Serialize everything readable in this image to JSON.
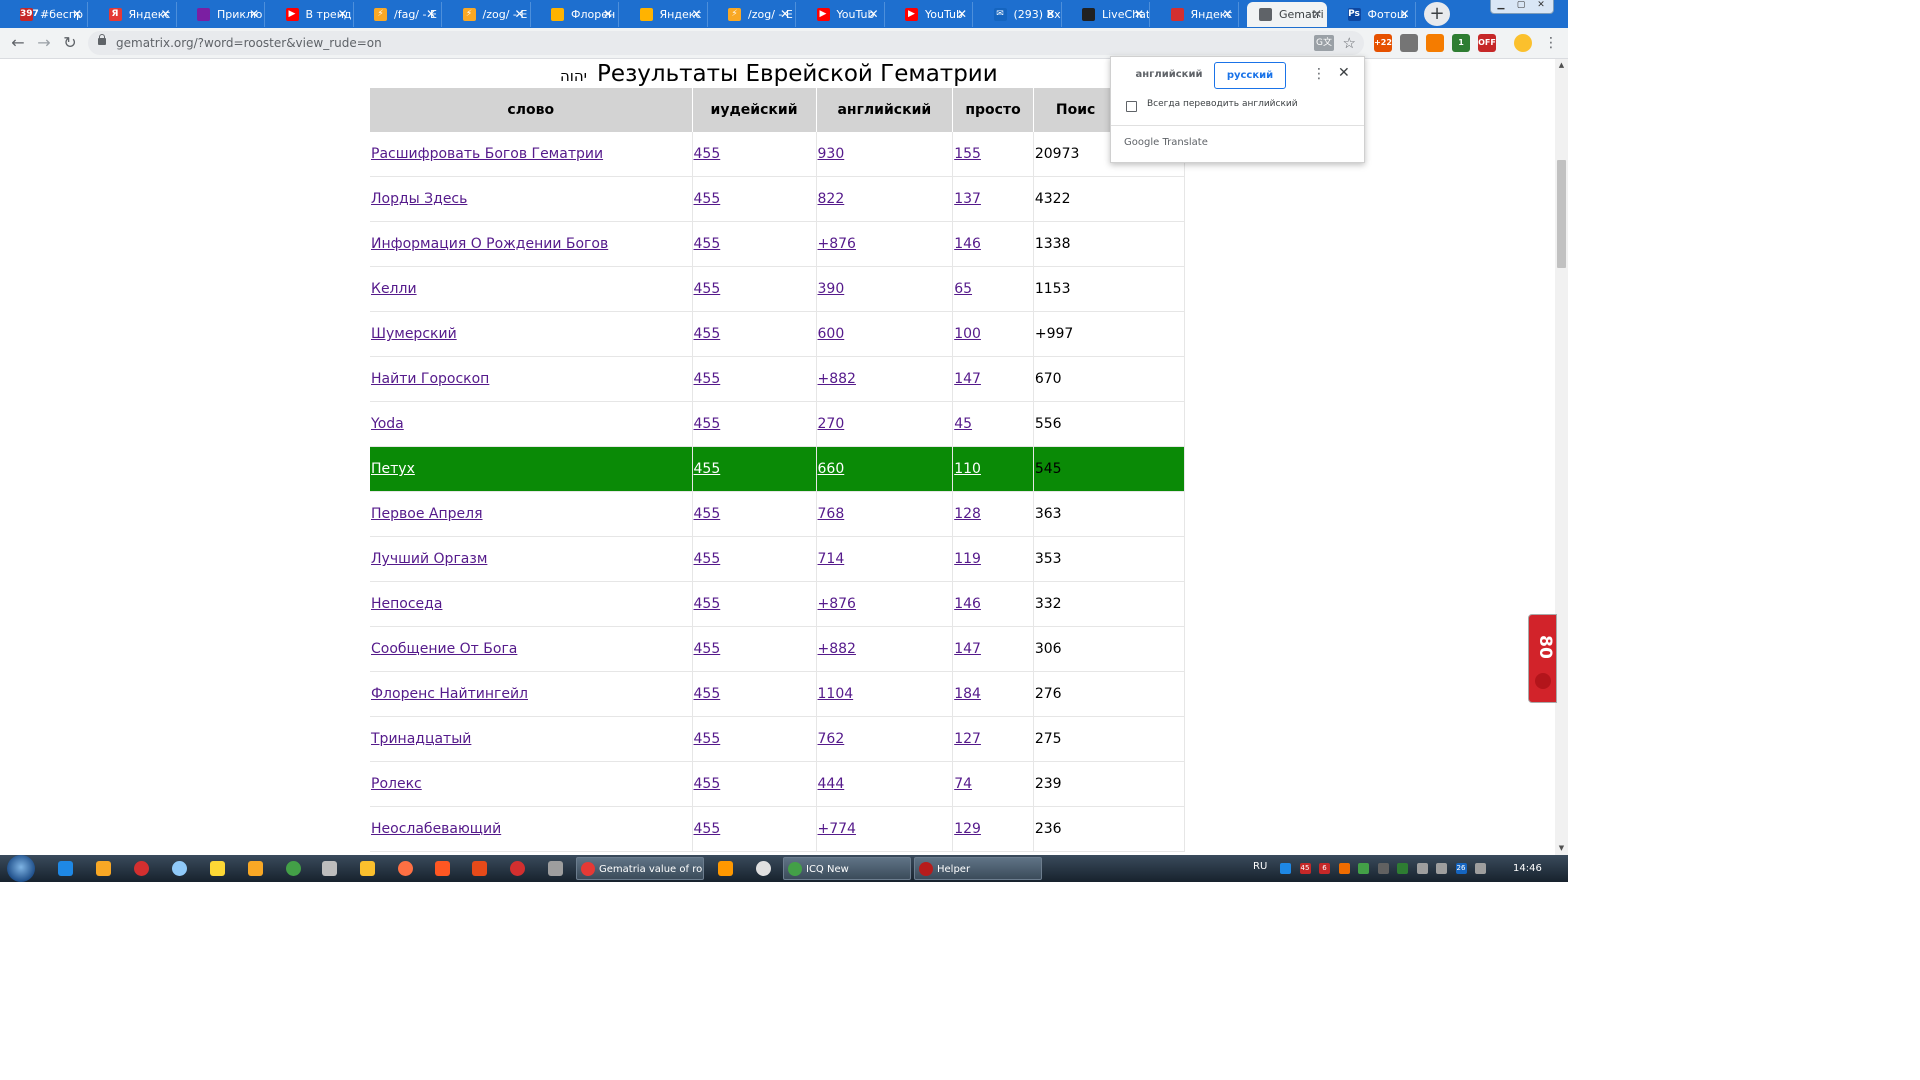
{
  "browser": {
    "tabs": [
      {
        "label": "#беспр",
        "icon_color": "#c62828",
        "icon_text": "397"
      },
      {
        "label": "Яндекс",
        "icon_color": "#e53935",
        "icon_text": "Я"
      },
      {
        "label": "Приклю",
        "icon_color": "#7b1fa2",
        "icon_text": ""
      },
      {
        "label": "В тренд",
        "icon_color": "#ff0000",
        "icon_text": "▶"
      },
      {
        "label": "/fag/ - E",
        "icon_color": "#f9a825",
        "icon_text": "⚡"
      },
      {
        "label": "/zog/ - E",
        "icon_color": "#f9a825",
        "icon_text": "⚡"
      },
      {
        "label": "Флорен",
        "icon_color": "#ffb300",
        "icon_text": ""
      },
      {
        "label": "Яндекс",
        "icon_color": "#ffb300",
        "icon_text": ""
      },
      {
        "label": "/zog/ - E",
        "icon_color": "#f9a825",
        "icon_text": "⚡"
      },
      {
        "label": "YouTub",
        "icon_color": "#ff0000",
        "icon_text": "▶"
      },
      {
        "label": "YouTub",
        "icon_color": "#ff0000",
        "icon_text": "▶"
      },
      {
        "label": "(293) Вх",
        "icon_color": "#1565c0",
        "icon_text": "✉"
      },
      {
        "label": "LiveChat",
        "icon_color": "#212121",
        "icon_text": ""
      },
      {
        "label": "Яндекс",
        "icon_color": "#d32f2f",
        "icon_text": ""
      },
      {
        "label": "Gematri",
        "icon_color": "#5f6368",
        "icon_text": "",
        "active": true
      },
      {
        "label": "Фотош",
        "icon_color": "#0d47a1",
        "icon_text": "Ps"
      }
    ],
    "url": "gematrix.org/?word=rooster&view_rude=on",
    "extensions": [
      {
        "name": "ext-weather",
        "color": "#e65100",
        "text": "+22"
      },
      {
        "name": "ext-gray",
        "color": "#757575",
        "text": ""
      },
      {
        "name": "ext-search",
        "color": "#f57c00",
        "text": ""
      },
      {
        "name": "ext-counter",
        "color": "#2e7d32",
        "text": "1"
      },
      {
        "name": "ext-adblock",
        "color": "#c62828",
        "text": "OFF"
      }
    ]
  },
  "page": {
    "hebrew_mark": "יהוה",
    "title": "Результаты Еврейской Гематрии",
    "table": {
      "headers": [
        "слово",
        "иудейский",
        "английский",
        "просто",
        "Поис"
      ],
      "rows": [
        {
          "word": "Расшифровать Богов Гематрии",
          "jewish": "455",
          "english": "930",
          "simple": "155",
          "pop": "20973"
        },
        {
          "word": "Лорды Здесь",
          "jewish": "455",
          "english": "822",
          "simple": "137",
          "pop": "4322"
        },
        {
          "word": "Информация О Рождении Богов",
          "jewish": "455",
          "english": "+876",
          "simple": "146",
          "pop": "1338"
        },
        {
          "word": "Келли",
          "jewish": "455",
          "english": "390",
          "simple": "65",
          "pop": "1153"
        },
        {
          "word": "Шумерский",
          "jewish": "455",
          "english": "600",
          "simple": "100",
          "pop": "+997"
        },
        {
          "word": "Найти Гороскоп",
          "jewish": "455",
          "english": "+882",
          "simple": "147",
          "pop": "670"
        },
        {
          "word": "Yoda",
          "jewish": "455",
          "english": "270",
          "simple": "45",
          "pop": "556"
        },
        {
          "word": "Петух",
          "jewish": "455",
          "english": "660",
          "simple": "110",
          "pop": "545",
          "highlight": true
        },
        {
          "word": "Первое Апреля",
          "jewish": "455",
          "english": "768",
          "simple": "128",
          "pop": "363"
        },
        {
          "word": "Лучший Оргазм",
          "jewish": "455",
          "english": "714",
          "simple": "119",
          "pop": "353"
        },
        {
          "word": "Непоседа",
          "jewish": "455",
          "english": "+876",
          "simple": "146",
          "pop": "332"
        },
        {
          "word": "Сообщение От Бога",
          "jewish": "455",
          "english": "+882",
          "simple": "147",
          "pop": "306"
        },
        {
          "word": "Флоренс Найтингейл",
          "jewish": "455",
          "english": "1104",
          "simple": "184",
          "pop": "276"
        },
        {
          "word": "Тринадцатый",
          "jewish": "455",
          "english": "762",
          "simple": "127",
          "pop": "275"
        },
        {
          "word": "Ролекс",
          "jewish": "455",
          "english": "444",
          "simple": "74",
          "pop": "239"
        },
        {
          "word": "Неослабевающий",
          "jewish": "455",
          "english": "+774",
          "simple": "129",
          "pop": "236"
        }
      ]
    },
    "highlight_color": "#0a8a06"
  },
  "translate_popup": {
    "lang_source": "английский",
    "lang_target": "русский",
    "always_translate": "Всегда переводить английский",
    "footer_brand": "Google",
    "footer_product": "Translate"
  },
  "side_widget": {
    "text": "80"
  },
  "taskbar": {
    "tasks": [
      {
        "label": "Gematria value of ro...",
        "icon_color": "#e53935"
      },
      {
        "label": "ICQ New",
        "icon_color": "#43a047"
      },
      {
        "label": "Helper",
        "icon_color": "#b71c1c"
      }
    ],
    "lang": "RU",
    "tray": [
      {
        "text": "",
        "color": "#1e88e5"
      },
      {
        "text": "45",
        "color": "#c62828"
      },
      {
        "text": "6",
        "color": "#c62828"
      },
      {
        "text": "",
        "color": "#ef6c00"
      },
      {
        "text": "",
        "color": "#43a047"
      },
      {
        "text": "",
        "color": "#616161"
      },
      {
        "text": "",
        "color": "#2e7d32"
      },
      {
        "text": "",
        "color": "#9e9e9e"
      },
      {
        "text": "",
        "color": "#9e9e9e"
      },
      {
        "text": "26",
        "color": "#1565c0"
      },
      {
        "text": "",
        "color": "#9e9e9e"
      }
    ],
    "clock": "14:46"
  }
}
